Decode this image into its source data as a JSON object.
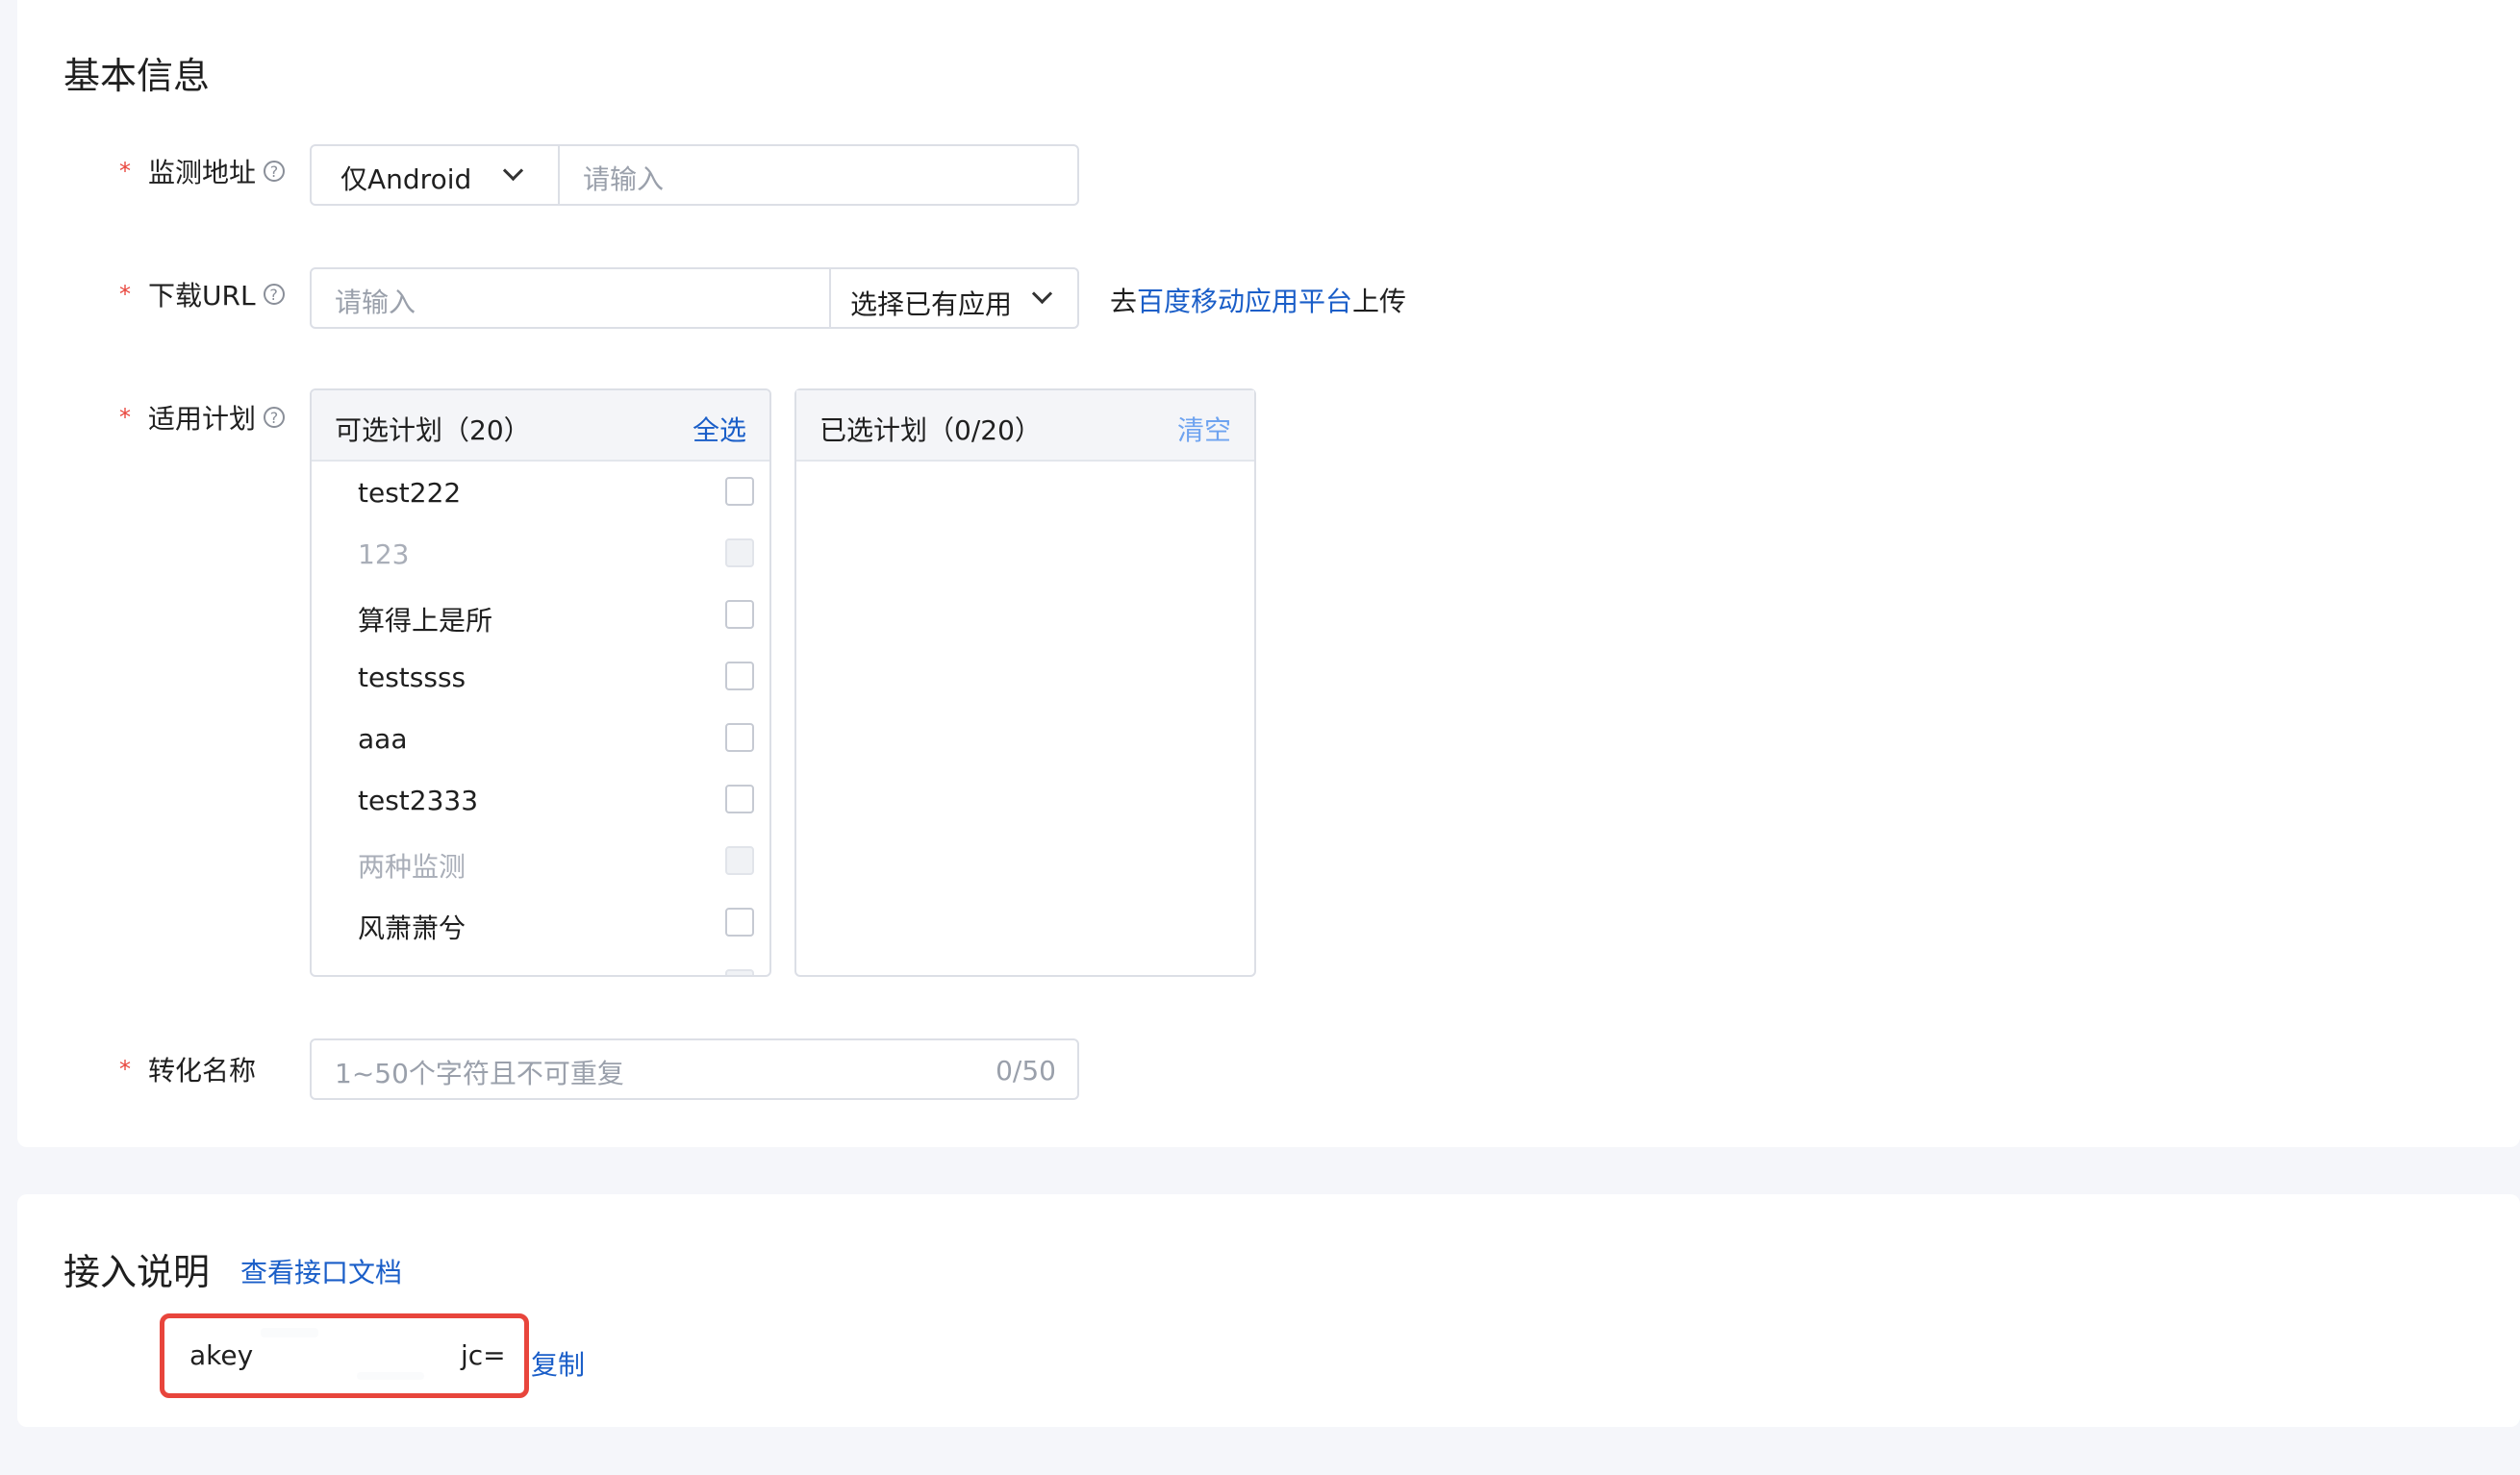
{
  "basic_section": {
    "title": "基本信息",
    "monitor": {
      "required": "*",
      "label": "监测地址",
      "help": "?",
      "platform_selected": "仅Android",
      "url_placeholder": "请输入"
    },
    "download": {
      "required": "*",
      "label": "下载URL",
      "help": "?",
      "url_placeholder": "请输入",
      "app_select_label": "选择已有应用",
      "upload_prefix": "去",
      "upload_link": "百度移动应用平台",
      "upload_suffix": "上传"
    },
    "plans": {
      "required": "*",
      "label": "适用计划",
      "help": "?",
      "available_header": "可选计划（20）",
      "select_all": "全选",
      "selected_header": "已选计划（0/20）",
      "clear": "清空",
      "items": [
        {
          "label": "test222",
          "disabled": false
        },
        {
          "label": "123",
          "disabled": true
        },
        {
          "label": "算得上是所",
          "disabled": false
        },
        {
          "label": "testssss",
          "disabled": false
        },
        {
          "label": "aaa",
          "disabled": false
        },
        {
          "label": "test2333",
          "disabled": false
        },
        {
          "label": "两种监测",
          "disabled": true
        },
        {
          "label": "风萧萧兮",
          "disabled": false
        }
      ]
    },
    "conversion": {
      "required": "*",
      "label": "转化名称",
      "placeholder": "1~50个字符且不可重复",
      "counter": "0/50"
    }
  },
  "access_section": {
    "title": "接入说明",
    "doc_link": "查看接口文档",
    "akey_prefix": "akey",
    "akey_suffix": "jc=",
    "copy": "复制"
  },
  "colors": {
    "required": "#e8453c",
    "link": "#1a5ec8",
    "highlight": "#e8453c"
  }
}
